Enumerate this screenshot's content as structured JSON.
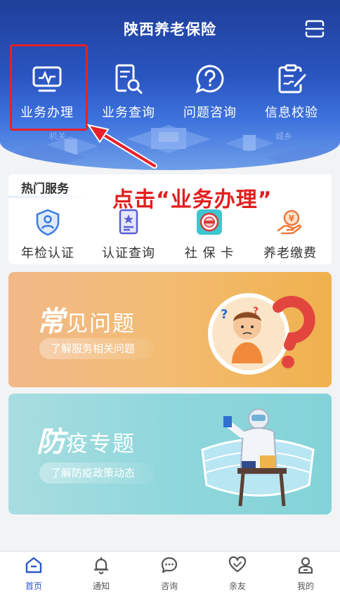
{
  "header": {
    "title": "陕西养老保险",
    "nav": [
      {
        "label": "业务办理",
        "icon": "monitor-chart-icon"
      },
      {
        "label": "业务查询",
        "icon": "document-search-icon"
      },
      {
        "label": "问题咨询",
        "icon": "question-bubble-icon"
      },
      {
        "label": "信息校验",
        "icon": "clipboard-pen-icon"
      }
    ]
  },
  "annotation": "点击“业务办理”",
  "hot_services": {
    "title": "热门服务",
    "items": [
      {
        "label": "年检认证",
        "icon": "shield-person-icon"
      },
      {
        "label": "认证查询",
        "icon": "certificate-star-icon"
      },
      {
        "label": "社 保 卡",
        "icon": "social-security-card-icon"
      },
      {
        "label": "养老缴费",
        "icon": "hand-coin-icon"
      }
    ]
  },
  "banners": [
    {
      "big": "常",
      "rest": "见问题",
      "button": "了解服务相关问题"
    },
    {
      "big": "防",
      "rest": "疫专题",
      "button": "了解防疫政策动态"
    }
  ],
  "tabbar": [
    {
      "label": "首页",
      "icon": "home-icon",
      "active": true
    },
    {
      "label": "通知",
      "icon": "bell-icon",
      "active": false
    },
    {
      "label": "咨询",
      "icon": "chat-bubble-icon",
      "active": false
    },
    {
      "label": "亲友",
      "icon": "heart-icon",
      "active": false
    },
    {
      "label": "我的",
      "icon": "user-icon",
      "active": false
    }
  ],
  "colors": {
    "header_blue": "#2a55c0",
    "highlight_red": "#e8202a",
    "tab_active": "#2a56c6"
  }
}
